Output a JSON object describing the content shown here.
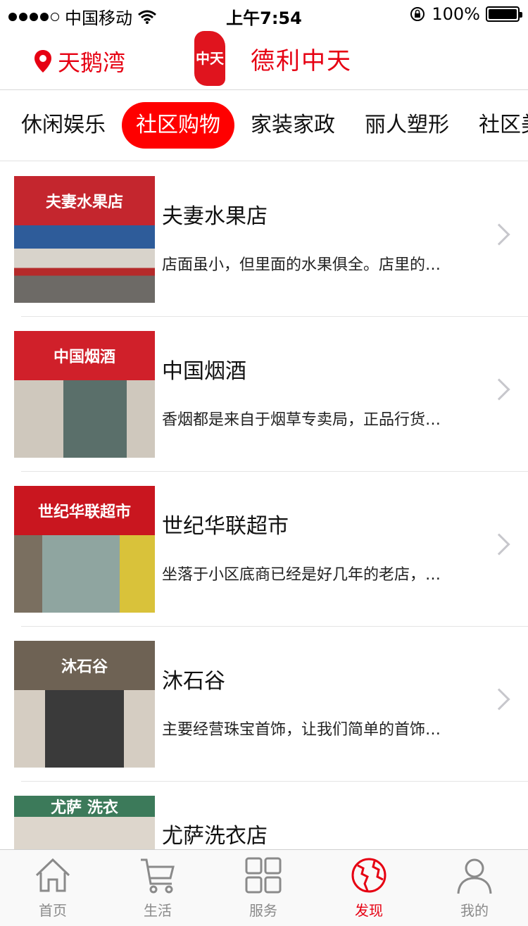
{
  "status_bar": {
    "carrier": "中国移动",
    "time": "上午7:54",
    "battery": "100%"
  },
  "header": {
    "location": "天鹅湾",
    "logo_text": "中天",
    "brand_name": "德利中天"
  },
  "tabs": [
    {
      "label": "休闲娱乐",
      "active": false
    },
    {
      "label": "社区购物",
      "active": true
    },
    {
      "label": "家装家政",
      "active": false
    },
    {
      "label": "丽人塑形",
      "active": false
    },
    {
      "label": "社区美",
      "active": false
    }
  ],
  "stores": [
    {
      "name": "夫妻水果店",
      "desc": "店面虽小，但里面的水果俱全。店里的…",
      "sign": "夫妻水果店",
      "color": "#c4262e"
    },
    {
      "name": "中国烟酒",
      "desc": "香烟都是来自于烟草专卖局，正品行货…",
      "sign": "中国烟酒",
      "color": "#d0202a"
    },
    {
      "name": "世纪华联超市",
      "desc": "坐落于小区底商已经是好几年的老店，…",
      "sign": "世纪华联超市",
      "color": "#c9161f"
    },
    {
      "name": "沐石谷",
      "desc": "主要经营珠宝首饰，让我们简单的首饰…",
      "sign": "沐石谷",
      "color": "#6e6254"
    },
    {
      "name": "尤萨洗衣店",
      "desc": "",
      "sign": "尤萨 洗衣",
      "color": "#3c7a5a"
    }
  ],
  "tabbar": [
    {
      "label": "首页",
      "icon": "home-icon",
      "active": false
    },
    {
      "label": "生活",
      "icon": "cart-icon",
      "active": false
    },
    {
      "label": "服务",
      "icon": "grid-icon",
      "active": false
    },
    {
      "label": "发现",
      "icon": "globe-icon",
      "active": true
    },
    {
      "label": "我的",
      "icon": "user-icon",
      "active": false
    }
  ],
  "colors": {
    "accent": "#e60012",
    "active_tab_bg": "#ff0000"
  }
}
